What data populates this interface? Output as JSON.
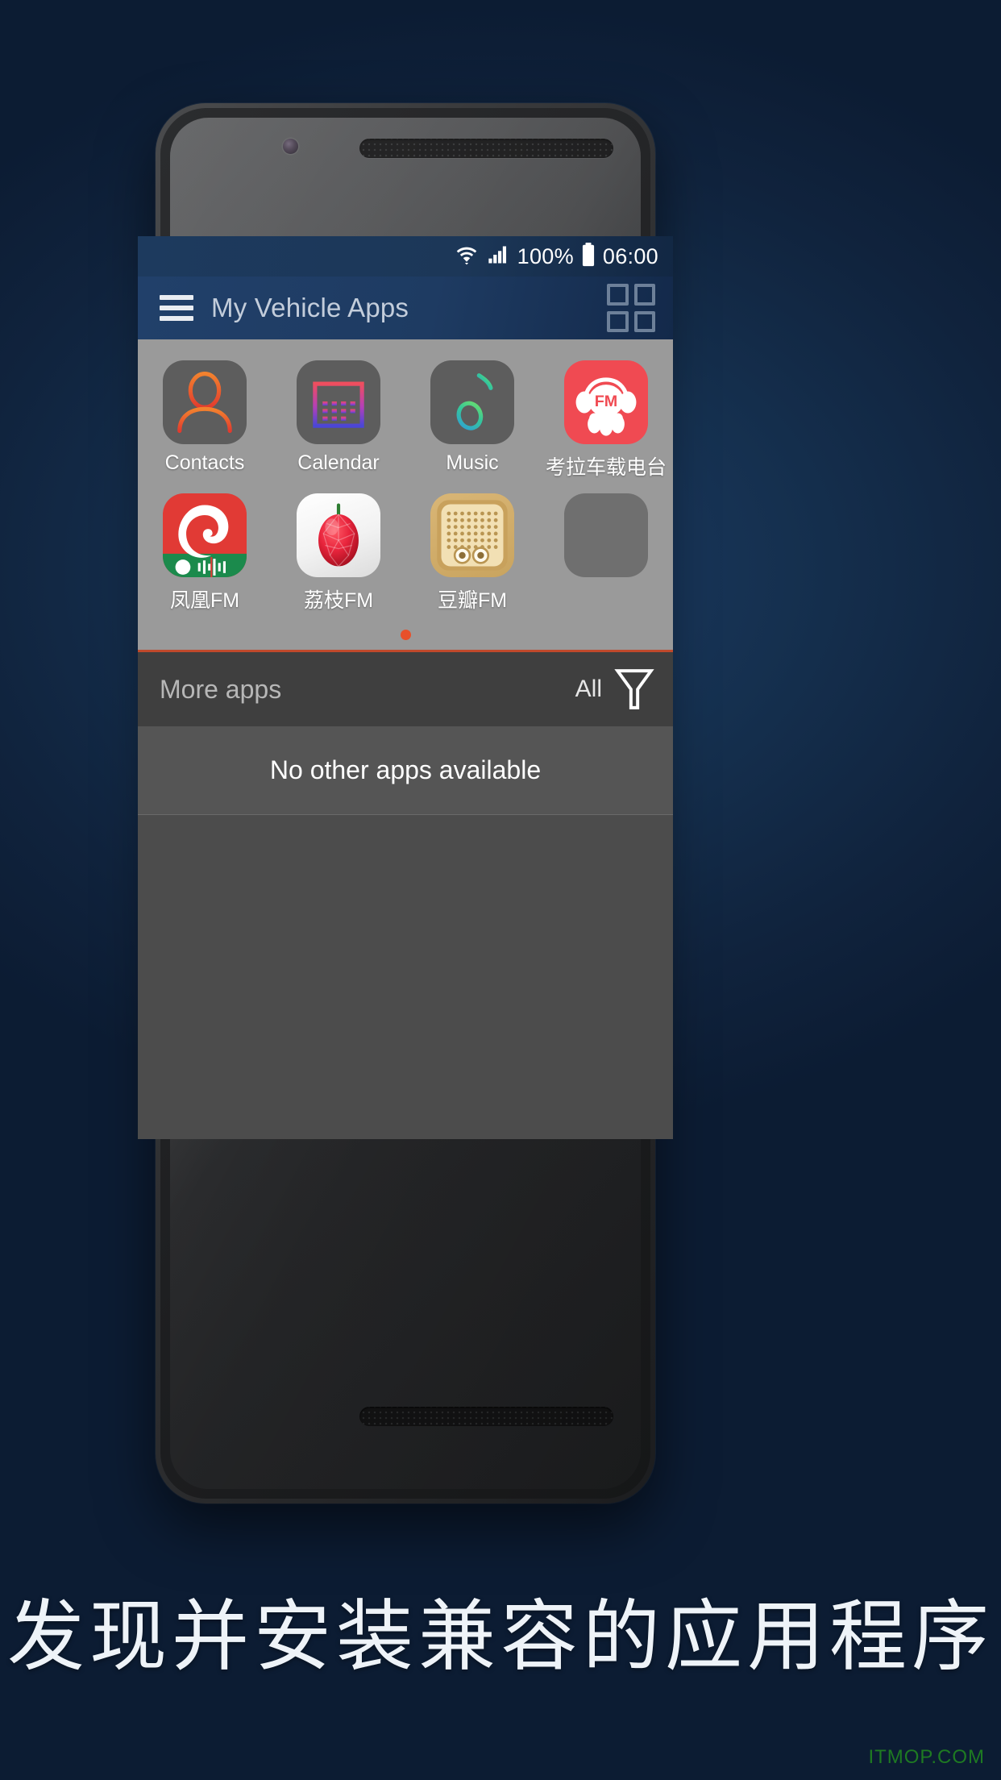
{
  "statusbar": {
    "wifi_icon": "wifi-icon",
    "signal_icon": "signal-bars-icon",
    "battery_percent": "100%",
    "battery_icon": "battery-full-icon",
    "time": "06:00"
  },
  "toolbar": {
    "menu_icon": "hamburger-menu-icon",
    "title": "My Vehicle Apps",
    "grid_icon": "grid-view-icon"
  },
  "apps": {
    "rows": [
      [
        {
          "label": "Contacts",
          "icon": "contact-person-icon",
          "style": "grey"
        },
        {
          "label": "Calendar",
          "icon": "calendar-icon",
          "style": "grey"
        },
        {
          "label": "Music",
          "icon": "music-note-icon",
          "style": "grey"
        },
        {
          "label": "考拉车载电台",
          "icon": "koala-fm-icon",
          "style": "koala"
        }
      ],
      [
        {
          "label": "凤凰FM",
          "icon": "phoenix-fm-icon",
          "style": "phoenix"
        },
        {
          "label": "荔枝FM",
          "icon": "lizhi-fm-icon",
          "style": "lizhi"
        },
        {
          "label": "豆瓣FM",
          "icon": "douban-fm-icon",
          "style": "douban"
        },
        {
          "label": "",
          "icon": "empty-slot-icon",
          "style": "placeholder"
        }
      ]
    ],
    "page_indicator": {
      "pages": 1,
      "active": 0,
      "color": "#e8502a"
    }
  },
  "more_apps": {
    "title": "More apps",
    "filter_label": "All",
    "filter_icon": "funnel-filter-icon",
    "empty_message": "No other apps available"
  },
  "caption": {
    "text": "发现并安装兼容的应用程序"
  },
  "watermark": {
    "text": "ITMOP.COM",
    "color": "#1e7a22"
  },
  "colors": {
    "background": "#10243f",
    "toolbar": "#1e3b62",
    "accent": "#e8502a",
    "pager_bg": "#9a9a9a",
    "list_bg": "#4c4c4c"
  }
}
